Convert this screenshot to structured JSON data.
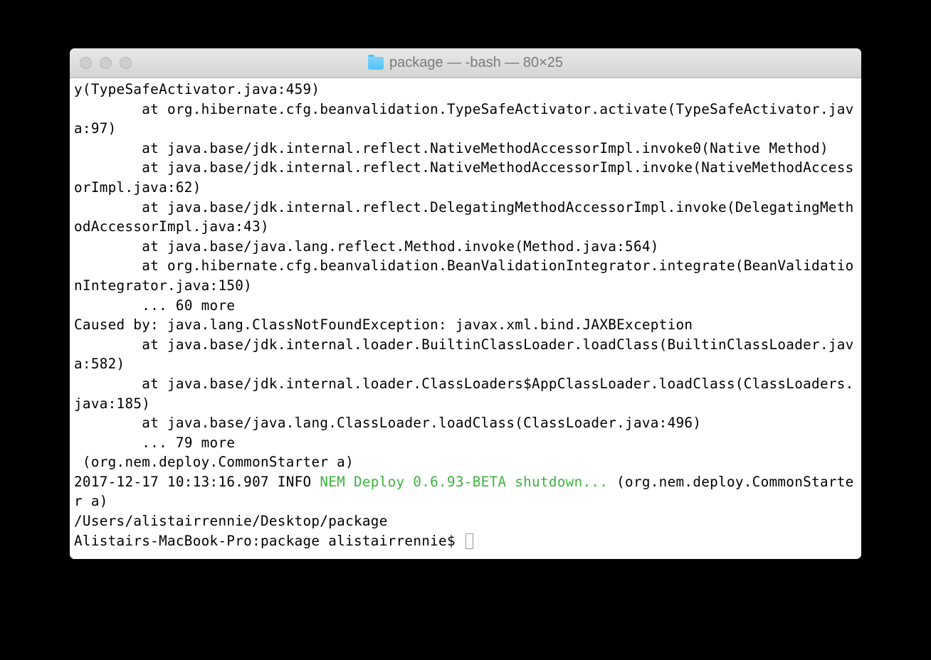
{
  "window": {
    "title": "package — -bash — 80×25"
  },
  "terminal": {
    "lines": [
      "y(TypeSafeActivator.java:459)",
      "        at org.hibernate.cfg.beanvalidation.TypeSafeActivator.activate(TypeSafeActivator.java:97)",
      "        at java.base/jdk.internal.reflect.NativeMethodAccessorImpl.invoke0(Native Method)",
      "        at java.base/jdk.internal.reflect.NativeMethodAccessorImpl.invoke(NativeMethodAccessorImpl.java:62)",
      "        at java.base/jdk.internal.reflect.DelegatingMethodAccessorImpl.invoke(DelegatingMethodAccessorImpl.java:43)",
      "        at java.base/java.lang.reflect.Method.invoke(Method.java:564)",
      "        at org.hibernate.cfg.beanvalidation.BeanValidationIntegrator.integrate(BeanValidationIntegrator.java:150)",
      "        ... 60 more",
      "Caused by: java.lang.ClassNotFoundException: javax.xml.bind.JAXBException",
      "        at java.base/jdk.internal.loader.BuiltinClassLoader.loadClass(BuiltinClassLoader.java:582)",
      "        at java.base/jdk.internal.loader.ClassLoaders$AppClassLoader.loadClass(ClassLoaders.java:185)",
      "        at java.base/java.lang.ClassLoader.loadClass(ClassLoader.java:496)",
      "        ... 79 more",
      " (org.nem.deploy.CommonStarter a)"
    ],
    "log_line": {
      "prefix": "2017-12-17 10:13:16.907 INFO ",
      "green_part": "NEM Deploy 0.6.93-BETA shutdown...",
      "suffix": " (org.nem.deploy.CommonStarter a)"
    },
    "path_line": "/Users/alistairrennie/Desktop/package",
    "prompt": "Alistairs-MacBook-Pro:package alistairrennie$ "
  }
}
